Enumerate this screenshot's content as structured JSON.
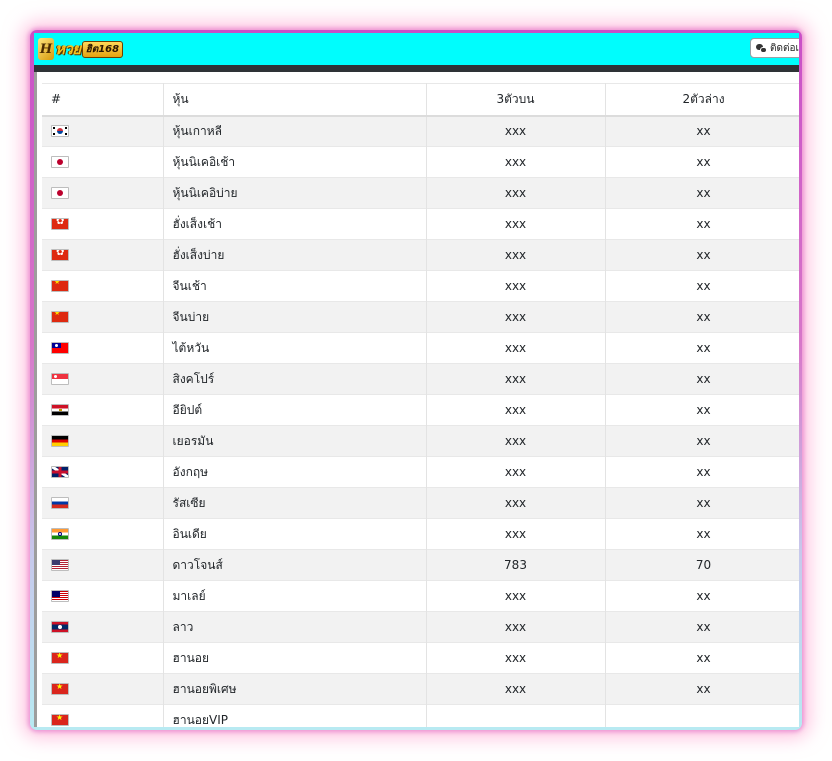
{
  "header": {
    "logo_mark": "H",
    "logo_text": "หวย",
    "logo_badge": "ฮิต168",
    "contact_label": "ติดต่อเรา"
  },
  "table": {
    "columns": [
      "#",
      "หุ้น",
      "3ตัวบน",
      "2ตัวล่าง"
    ],
    "rows": [
      {
        "flag": "kr",
        "name": "หุ้นเกาหลี",
        "top3": "xxx",
        "bottom2": "xx"
      },
      {
        "flag": "jp",
        "name": "หุ้นนิเคอิเช้า",
        "top3": "xxx",
        "bottom2": "xx"
      },
      {
        "flag": "jp",
        "name": "หุ้นนิเคอิบ่าย",
        "top3": "xxx",
        "bottom2": "xx"
      },
      {
        "flag": "hk",
        "name": "ฮั่งเส็งเช้า",
        "top3": "xxx",
        "bottom2": "xx"
      },
      {
        "flag": "hk",
        "name": "ฮั่งเส็งบ่าย",
        "top3": "xxx",
        "bottom2": "xx"
      },
      {
        "flag": "cn",
        "name": "จีนเช้า",
        "top3": "xxx",
        "bottom2": "xx"
      },
      {
        "flag": "cn",
        "name": "จีนบ่าย",
        "top3": "xxx",
        "bottom2": "xx"
      },
      {
        "flag": "tw",
        "name": "ไต้หวัน",
        "top3": "xxx",
        "bottom2": "xx"
      },
      {
        "flag": "sg",
        "name": "สิงคโปร์",
        "top3": "xxx",
        "bottom2": "xx"
      },
      {
        "flag": "eg",
        "name": "อียิปต์",
        "top3": "xxx",
        "bottom2": "xx"
      },
      {
        "flag": "de",
        "name": "เยอรมัน",
        "top3": "xxx",
        "bottom2": "xx"
      },
      {
        "flag": "gb",
        "name": "อังกฤษ",
        "top3": "xxx",
        "bottom2": "xx"
      },
      {
        "flag": "ru",
        "name": "รัสเซีย",
        "top3": "xxx",
        "bottom2": "xx"
      },
      {
        "flag": "in",
        "name": "อินเดีย",
        "top3": "xxx",
        "bottom2": "xx"
      },
      {
        "flag": "us",
        "name": "ดาวโจนส์",
        "top3": "783",
        "bottom2": "70"
      },
      {
        "flag": "my",
        "name": "มาเลย์",
        "top3": "xxx",
        "bottom2": "xx"
      },
      {
        "flag": "la",
        "name": "ลาว",
        "top3": "xxx",
        "bottom2": "xx"
      },
      {
        "flag": "vn",
        "name": "ฮานอย",
        "top3": "xxx",
        "bottom2": "xx"
      },
      {
        "flag": "vn",
        "name": "ฮานอยพิเศษ",
        "top3": "xxx",
        "bottom2": "xx"
      },
      {
        "flag": "vn",
        "name": "ฮานอยVIP",
        "top3": "",
        "bottom2": ""
      }
    ]
  }
}
